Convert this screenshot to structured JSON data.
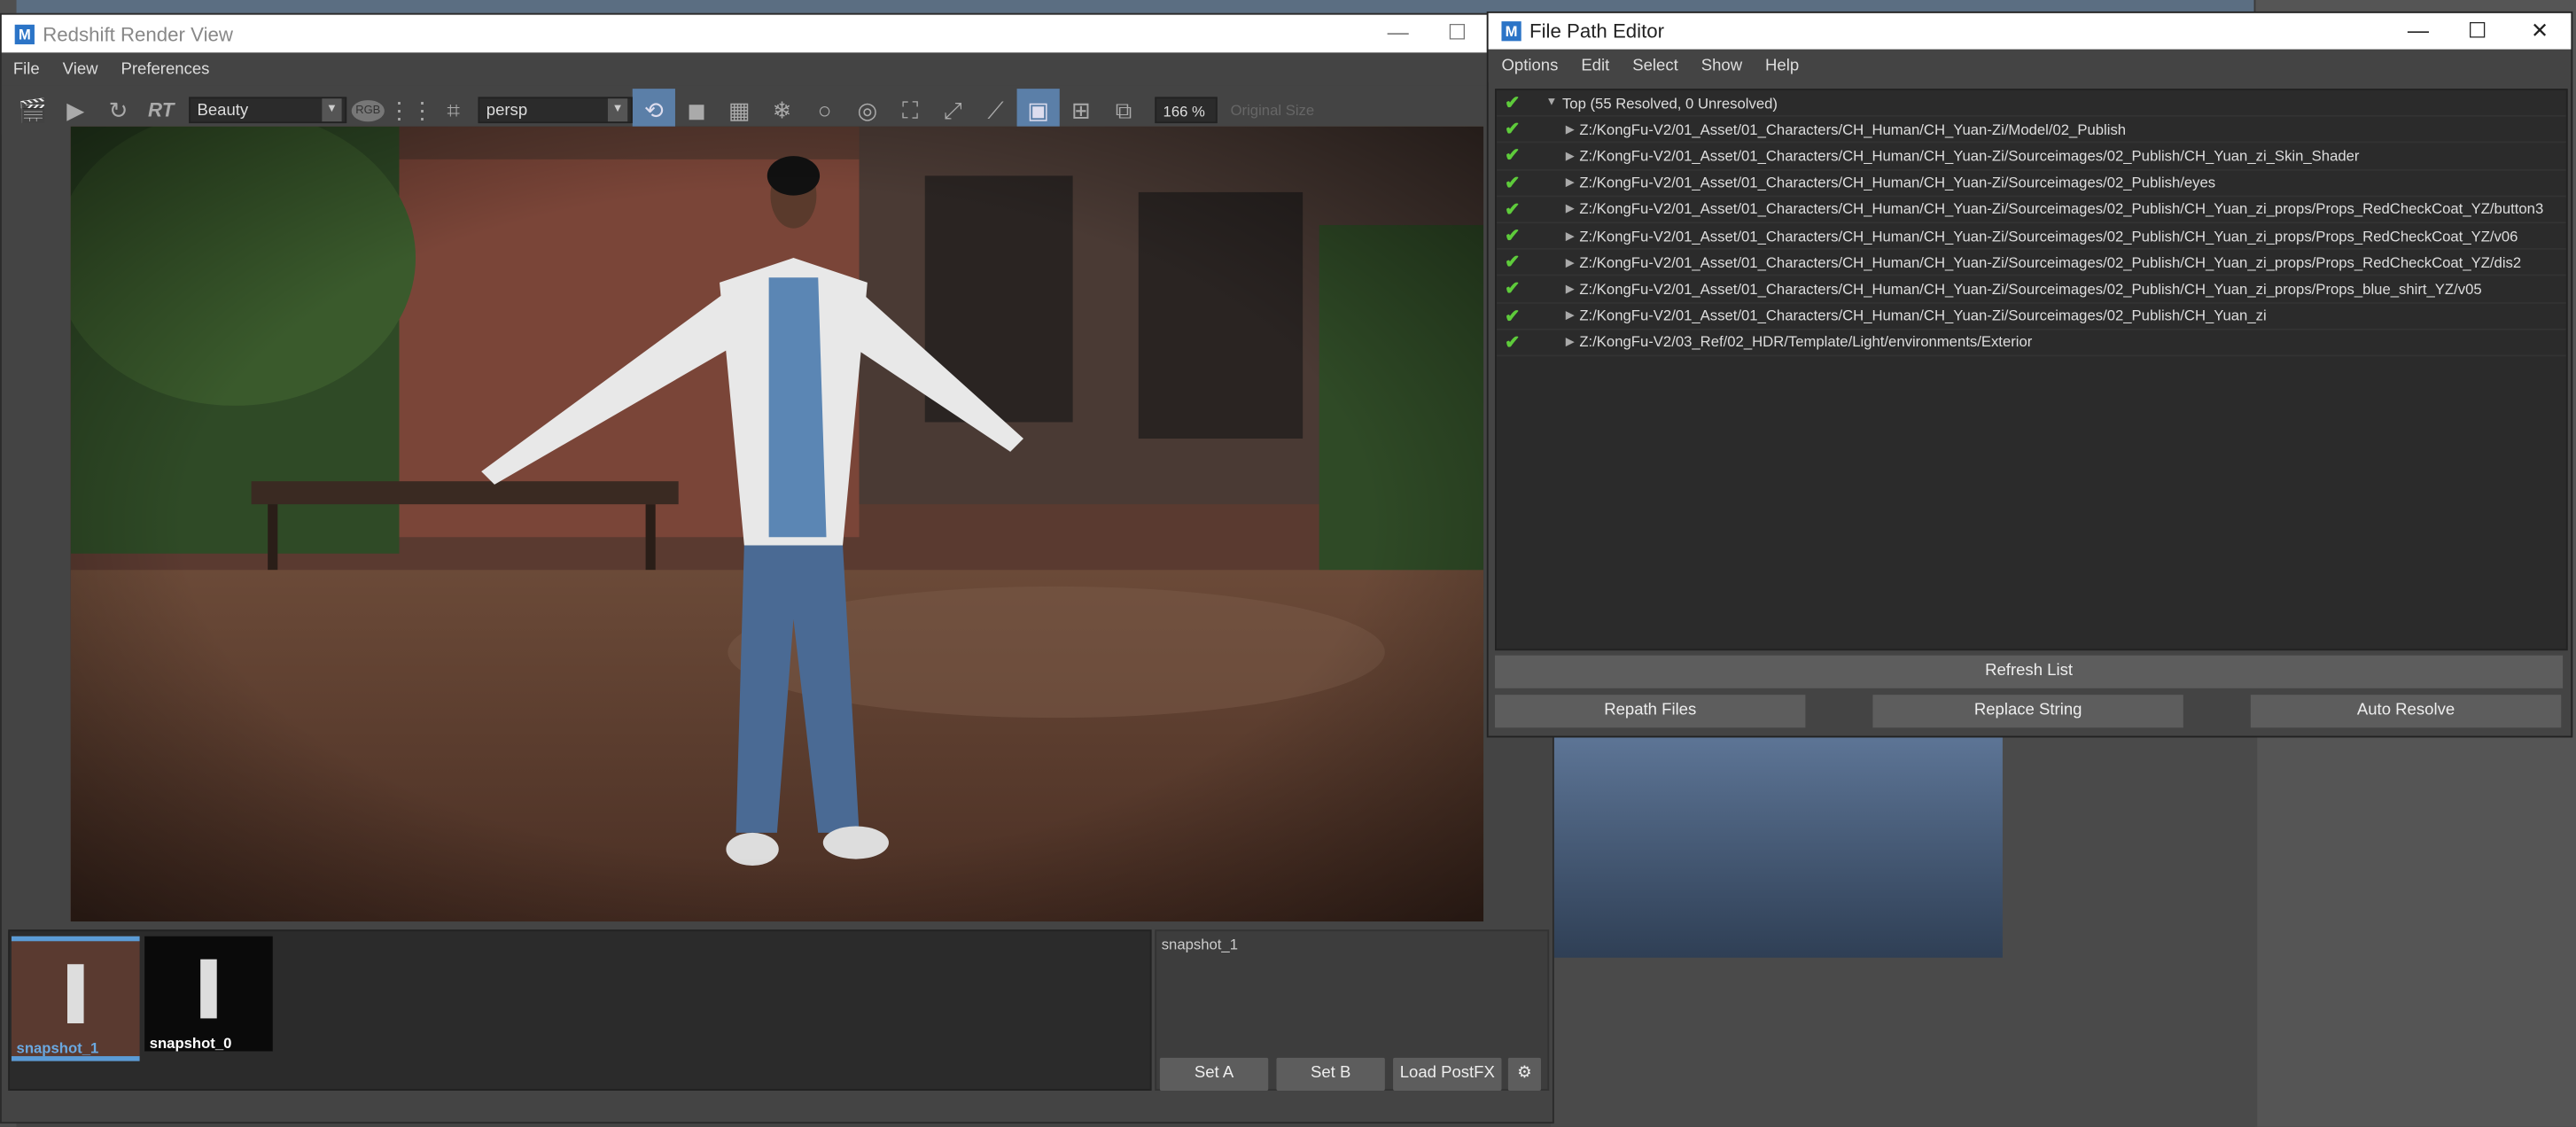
{
  "redshift": {
    "title": "Redshift Render View",
    "menu": [
      "File",
      "View",
      "Preferences"
    ],
    "aov_value": "Beauty",
    "rgb_label": "RGB",
    "rt_label": "RT",
    "camera_value": "persp",
    "zoom_value": "166 %",
    "original_size_label": "Original Size",
    "snapshots": [
      {
        "label": "snapshot_1"
      },
      {
        "label": "snapshot_0"
      }
    ],
    "snapshot_info": "snapshot_1",
    "set_a_label": "Set A",
    "set_b_label": "Set B",
    "load_postfx_label": "Load PostFX"
  },
  "fpe": {
    "title": "File Path Editor",
    "menu": [
      "Options",
      "Edit",
      "Select",
      "Show",
      "Help"
    ],
    "top_label": "Top (55 Resolved, 0 Unresolved)",
    "paths": [
      "Z:/KongFu-V2/01_Asset/01_Characters/CH_Human/CH_Yuan-Zi/Model/02_Publish",
      "Z:/KongFu-V2/01_Asset/01_Characters/CH_Human/CH_Yuan-Zi/Sourceimages/02_Publish/CH_Yuan_zi_Skin_Shader",
      "Z:/KongFu-V2/01_Asset/01_Characters/CH_Human/CH_Yuan-Zi/Sourceimages/02_Publish/eyes",
      "Z:/KongFu-V2/01_Asset/01_Characters/CH_Human/CH_Yuan-Zi/Sourceimages/02_Publish/CH_Yuan_zi_props/Props_RedCheckCoat_YZ/button3",
      "Z:/KongFu-V2/01_Asset/01_Characters/CH_Human/CH_Yuan-Zi/Sourceimages/02_Publish/CH_Yuan_zi_props/Props_RedCheckCoat_YZ/v06",
      "Z:/KongFu-V2/01_Asset/01_Characters/CH_Human/CH_Yuan-Zi/Sourceimages/02_Publish/CH_Yuan_zi_props/Props_RedCheckCoat_YZ/dis2",
      "Z:/KongFu-V2/01_Asset/01_Characters/CH_Human/CH_Yuan-Zi/Sourceimages/02_Publish/CH_Yuan_zi_props/Props_blue_shirt_YZ/v05",
      "Z:/KongFu-V2/01_Asset/01_Characters/CH_Human/CH_Yuan-Zi/Sourceimages/02_Publish/CH_Yuan_zi",
      "Z:/KongFu-V2/03_Ref/02_HDR/Template/Light/environments/Exterior"
    ],
    "refresh_label": "Refresh List",
    "repath_label": "Repath Files",
    "replace_label": "Replace String",
    "auto_label": "Auto Resolve"
  },
  "colors": {
    "accent": "#5b7fa8",
    "check": "#5ecb3b",
    "panel": "#444444"
  }
}
